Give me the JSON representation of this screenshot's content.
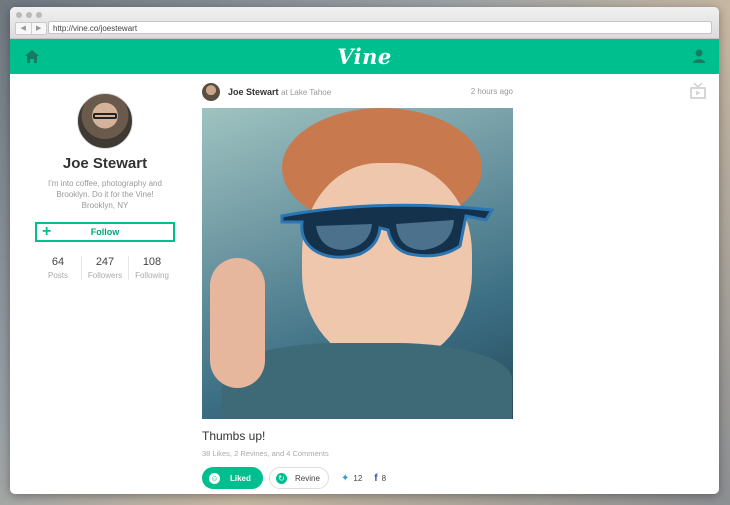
{
  "browser": {
    "url": "http://vine.co/joestewart",
    "back_arrow": "◀",
    "forward_arrow": "▶"
  },
  "header": {
    "logo_text": "Vine",
    "brand_color": "#00bf8f",
    "left_icon": "home-icon",
    "right_icon": "user-icon"
  },
  "profile": {
    "name": "Joe Stewart",
    "bio": [
      "I'm into coffee, photography and",
      "Brooklyn. Do it for the Vine!",
      "Brooklyn, NY"
    ],
    "follow_label": "Follow",
    "follow_icon": "+",
    "stats": [
      {
        "value": "64",
        "label": "Posts"
      },
      {
        "value": "247",
        "label": "Followers"
      },
      {
        "value": "108",
        "label": "Following"
      }
    ]
  },
  "post": {
    "author": "Joe Stewart",
    "location": "at Lake Tahoe",
    "time": "2 hours ago",
    "caption": "Thumbs up!",
    "counts": "38 Likes, 2 Revines, and 4 Comments",
    "liked_label": "Liked",
    "revine_label": "Revine",
    "twitter_count": "12",
    "facebook_count": "8",
    "twitter_icon": "twitter-icon",
    "facebook_icon": "facebook-icon"
  },
  "side_icon": "tv-icon"
}
